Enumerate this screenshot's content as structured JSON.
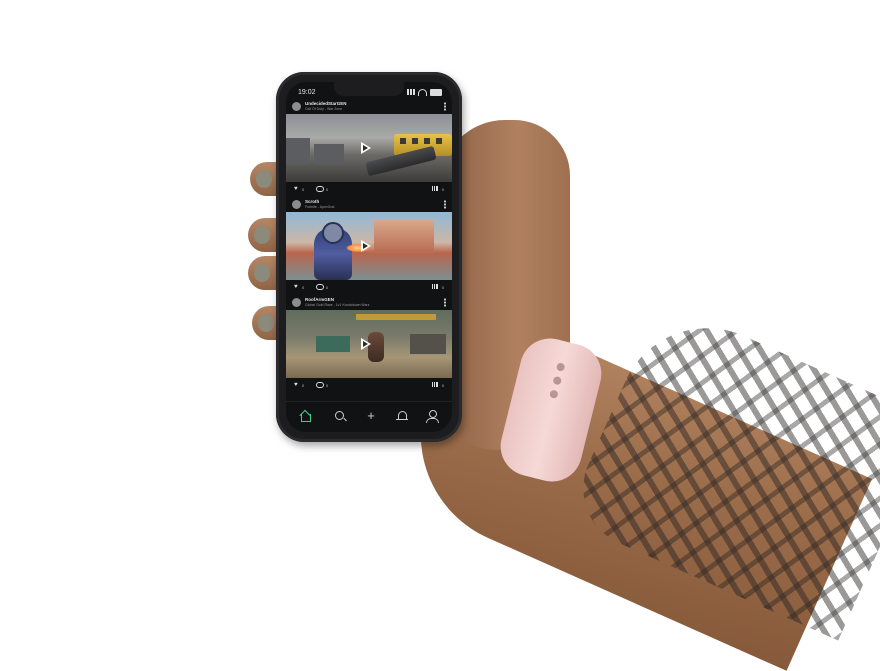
{
  "status_bar": {
    "time": "19:02"
  },
  "feed": {
    "posts": [
      {
        "username": "UndecidedStarGEN",
        "subtitle": "Call Of Duty - War Zone",
        "likes": "0",
        "comments": "0",
        "views": "0"
      },
      {
        "username": "Scroth",
        "subtitle": "Fortnite - ApexGod",
        "likes": "0",
        "comments": "0",
        "views": "0"
      },
      {
        "username": "RoofArmGEN",
        "subtitle": "Global Gold Race - 1v1 Knockdown Warz",
        "likes": "0",
        "comments": "0",
        "views": "0"
      }
    ]
  },
  "bottom_nav": {
    "plus_glyph": "+",
    "items": [
      "home-icon",
      "search-icon",
      "plus-icon",
      "bell-icon",
      "profile-icon"
    ],
    "active": "home-icon",
    "active_color": "#3fd08e"
  },
  "watch": {
    "band_color": "#f3d1cf"
  }
}
